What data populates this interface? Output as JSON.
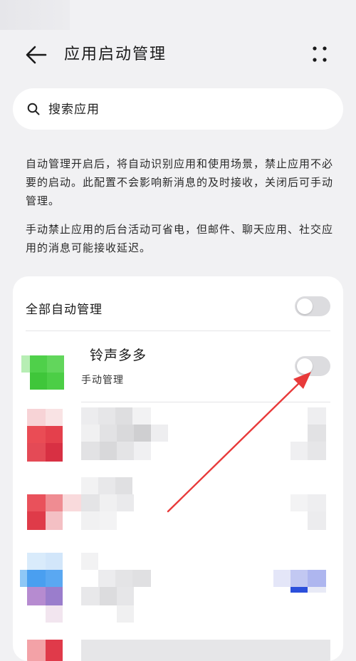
{
  "header": {
    "title": "应用启动管理",
    "back_icon": "arrow-left-icon",
    "more_icon": "more-dots-icon"
  },
  "search": {
    "placeholder": "搜索应用",
    "icon": "search-icon"
  },
  "description": {
    "paragraph1": "自动管理开启后，将自动识别应用和使用场景，禁止应用不必要的启动。此配置不会影响新消息的及时接收，关闭后可手动管理。",
    "paragraph2": "手动禁止应用的后台活动可省电，但邮件、聊天应用、社交应用的消息可能接收延迟。"
  },
  "list": {
    "all_auto_label": "全部自动管理",
    "all_auto_on": false,
    "apps": [
      {
        "name": "铃声多多",
        "status": "手动管理",
        "toggle_on": false,
        "icon_color": "#4fd04a"
      }
    ]
  },
  "colors": {
    "background": "#f1f1f3",
    "card": "#ffffff",
    "toggle_off": "#dcdcdf",
    "annotation_arrow": "#e83a3a"
  }
}
